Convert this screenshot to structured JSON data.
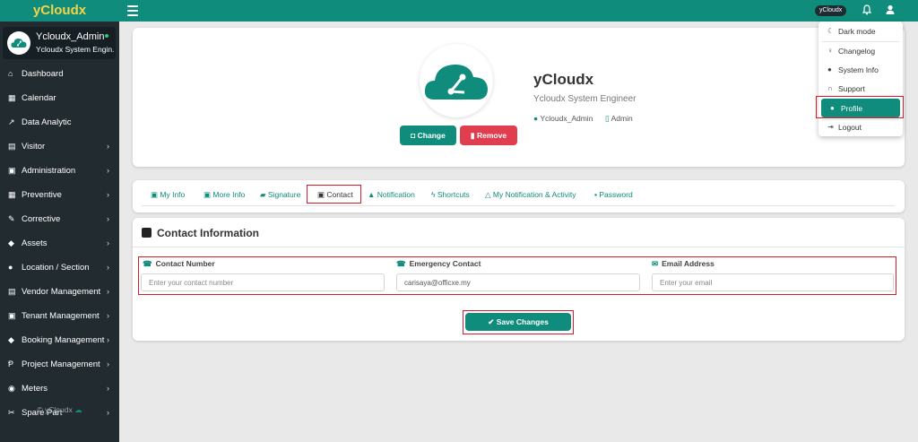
{
  "app": {
    "brand": "yCloudx",
    "top_chip": "yCloudx"
  },
  "user": {
    "name": "Ycloudx_Admin",
    "role": "Ycloudx System Engin..."
  },
  "sidebar": {
    "items": [
      {
        "label": "Dashboard",
        "icon": "dashboard-icon",
        "has_children": false
      },
      {
        "label": "Calendar",
        "icon": "calendar-icon",
        "has_children": false
      },
      {
        "label": "Data Analytic",
        "icon": "chart-icon",
        "has_children": false
      },
      {
        "label": "Visitor",
        "icon": "id-card-icon",
        "has_children": true
      },
      {
        "label": "Administration",
        "icon": "admin-icon",
        "has_children": true
      },
      {
        "label": "Preventive",
        "icon": "calendar-grid-icon",
        "has_children": true
      },
      {
        "label": "Corrective",
        "icon": "wrench-icon",
        "has_children": true
      },
      {
        "label": "Assets",
        "icon": "tag-icon",
        "has_children": true
      },
      {
        "label": "Location / Section",
        "icon": "globe-icon",
        "has_children": true
      },
      {
        "label": "Vendor Management",
        "icon": "vendor-card-icon",
        "has_children": true
      },
      {
        "label": "Tenant Management",
        "icon": "tenant-icon",
        "has_children": true
      },
      {
        "label": "Booking Management",
        "icon": "booking-tag-icon",
        "has_children": true
      },
      {
        "label": "Project Management",
        "icon": "project-icon",
        "has_children": true
      },
      {
        "label": "Meters",
        "icon": "meter-icon",
        "has_children": true
      },
      {
        "label": "Spare Part",
        "icon": "spare-part-icon",
        "has_children": true
      }
    ],
    "footer": "© yCloudx"
  },
  "profile": {
    "title": "yCloudx",
    "subtitle": "Ycloudx System Engineer",
    "username": "Ycloudx_Admin",
    "user_type": "Admin",
    "change_label": "Change",
    "remove_label": "Remove"
  },
  "tabs": [
    {
      "label": "My Info",
      "icon": "id-card-icon"
    },
    {
      "label": "More Info",
      "icon": "user-square-icon"
    },
    {
      "label": "Signature",
      "icon": "pen-icon"
    },
    {
      "label": "Contact",
      "icon": "phone-square-icon"
    },
    {
      "label": "Notification",
      "icon": "bell-icon"
    },
    {
      "label": "Shortcuts",
      "icon": "bolt-icon"
    },
    {
      "label": "My Notification & Activity",
      "icon": "bell-outline-icon"
    },
    {
      "label": "Password",
      "icon": "lock-icon"
    }
  ],
  "contact": {
    "section_title": "Contact Information",
    "contact_number_label": "Contact Number",
    "contact_number_value": "",
    "contact_number_placeholder": "Enter your contact number",
    "emergency_label": "Emergency Contact",
    "emergency_value": "carisaya@officxe.my",
    "email_label": "Email Address",
    "email_value": "",
    "email_placeholder": "Enter your email",
    "save_label": "Save Changes"
  },
  "dropdown": {
    "items": [
      {
        "label": "Dark mode",
        "icon": "moon-icon"
      },
      {
        "label": "Changelog",
        "icon": "bulb-icon"
      },
      {
        "label": "System Info",
        "icon": "info-icon"
      },
      {
        "label": "Support",
        "icon": "headset-icon"
      },
      {
        "label": "Profile",
        "icon": "user-icon"
      },
      {
        "label": "Logout",
        "icon": "logout-icon"
      }
    ]
  },
  "colors": {
    "accent": "#0f8c7b",
    "danger": "#e03e4e",
    "sidebar": "#222b30",
    "brand_text": "#f5d447"
  }
}
